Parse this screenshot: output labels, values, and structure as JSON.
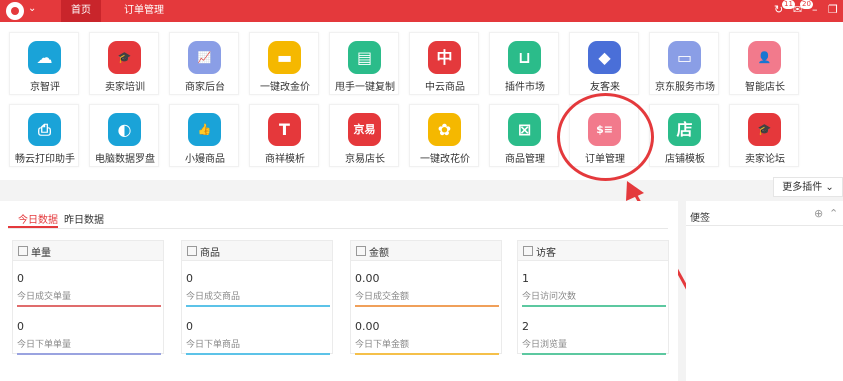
{
  "topbar": {
    "logo_icon": "monkey-logo-icon",
    "tabs": [
      {
        "label": "首页",
        "active": true
      },
      {
        "label": "订单管理",
        "active": false
      }
    ],
    "right_icons": [
      {
        "icon": "refresh-icon",
        "badge": "11"
      },
      {
        "icon": "message-icon",
        "badge": "20"
      },
      {
        "icon": "window-icon",
        "badge": ""
      }
    ],
    "accent": "#e4393c"
  },
  "apps": [
    {
      "label": "京智评",
      "icon": "cloud-icon",
      "color": "#1aa3d8",
      "glyph": "☁"
    },
    {
      "label": "卖家培训",
      "icon": "graduation-cap-icon",
      "color": "#e5383b",
      "glyph": "🎓"
    },
    {
      "label": "商家后台",
      "icon": "chart-icon",
      "color": "#8a9ee6",
      "glyph": "📈"
    },
    {
      "label": "一键改金价",
      "icon": "gold-icon",
      "color": "#f5b800",
      "glyph": "▬"
    },
    {
      "label": "甩手一键复制",
      "icon": "copy-icon",
      "color": "#2bbc8a",
      "glyph": "▤"
    },
    {
      "label": "中云商品",
      "icon": "zhongyun-logo-icon",
      "color": "#e4393c",
      "glyph": "中"
    },
    {
      "label": "插件市场",
      "icon": "basket-icon",
      "color": "#2bbc8a",
      "glyph": "⊔"
    },
    {
      "label": "友客来",
      "icon": "diamond-icon",
      "color": "#4a6fd8",
      "glyph": "◆"
    },
    {
      "label": "京东服务市场",
      "icon": "browser-icon",
      "color": "#8a9ee6",
      "glyph": "▭"
    },
    {
      "label": "智能店长",
      "icon": "user-icon",
      "color": "#f27a8c",
      "glyph": "👤"
    },
    {
      "label": "畅云打印助手",
      "icon": "printer-icon",
      "color": "#1aa3d8",
      "glyph": "⎙"
    },
    {
      "label": "电脑数据罗盘",
      "icon": "compass-icon",
      "color": "#1aa3d8",
      "glyph": "◐"
    },
    {
      "label": "小嫚商品",
      "icon": "thumbs-up-icon",
      "color": "#1aa3d8",
      "glyph": "👍"
    },
    {
      "label": "商祥模析",
      "icon": "tag-icon",
      "color": "#e5383b",
      "glyph": "T"
    },
    {
      "label": "京易店长",
      "icon": "jingyi-icon",
      "color": "#e5383b",
      "glyph": "京易"
    },
    {
      "label": "一键改花价",
      "icon": "tulip-icon",
      "color": "#f5b800",
      "glyph": "✿"
    },
    {
      "label": "商品管理",
      "icon": "box-icon",
      "color": "#2bbc8a",
      "glyph": "⊠"
    },
    {
      "label": "订单管理",
      "icon": "order-list-icon",
      "color": "#f27a8c",
      "glyph": "$≡"
    },
    {
      "label": "店铺模板",
      "icon": "store-icon",
      "color": "#2bbc8a",
      "glyph": "店"
    },
    {
      "label": "卖家论坛",
      "icon": "graduation-cap-icon",
      "color": "#e5383b",
      "glyph": "🎓"
    }
  ],
  "annotation": {
    "color": "#e4393c"
  },
  "more_plugins": "更多插件",
  "data_tabs": [
    {
      "label": "今日数据",
      "active": true
    },
    {
      "label": "昨日数据",
      "active": false
    }
  ],
  "cards": [
    {
      "title": "单量",
      "rows": [
        {
          "value": "0",
          "desc": "今日成交单量",
          "color": "#e06c6c"
        },
        {
          "value": "0",
          "desc": "今日下单单量",
          "color": "#9aa3e0"
        }
      ]
    },
    {
      "title": "商品",
      "rows": [
        {
          "value": "0",
          "desc": "今日成交商品",
          "color": "#5cc3e8"
        },
        {
          "value": "0",
          "desc": "今日下单商品",
          "color": "#5cc3e8"
        }
      ]
    },
    {
      "title": "金额",
      "rows": [
        {
          "value": "0.00",
          "desc": "今日成交金额",
          "color": "#f0a05a"
        },
        {
          "value": "0.00",
          "desc": "今日下单金额",
          "color": "#f5c04a"
        }
      ]
    },
    {
      "title": "访客",
      "rows": [
        {
          "value": "1",
          "desc": "今日访问次数",
          "color": "#5cc8a0"
        },
        {
          "value": "2",
          "desc": "今日浏览量",
          "color": "#5cc8a0"
        }
      ]
    }
  ],
  "memo": {
    "title": "便签"
  }
}
